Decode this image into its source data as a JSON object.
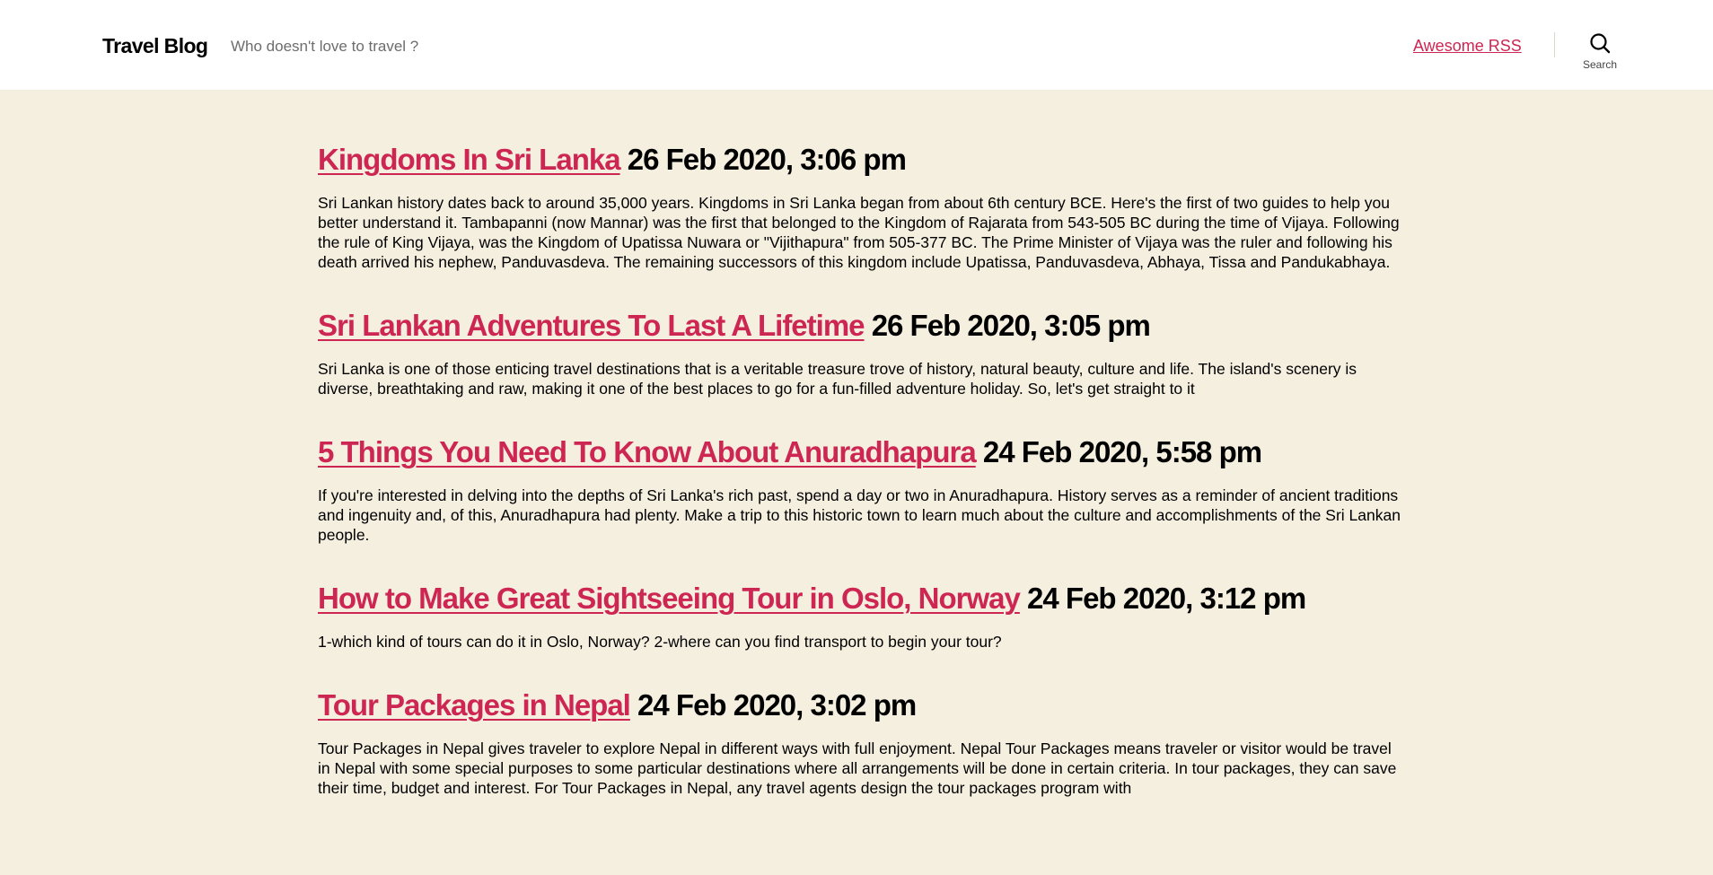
{
  "header": {
    "site_title": "Travel Blog",
    "site_description": "Who doesn't love to travel ?",
    "nav_link": "Awesome RSS",
    "search_label": "Search"
  },
  "posts": [
    {
      "title": "Kingdoms In Sri Lanka",
      "date": "26 Feb 2020, 3:06 pm",
      "excerpt": "Sri Lankan history dates back to around 35,000 years. Kingdoms in Sri Lanka began from about 6th century BCE. Here's the first of two guides to help you better understand it. Tambapanni (now Mannar) was the first that belonged to the Kingdom of Rajarata from 543-505 BC during the time of Vijaya. Following the rule of King Vijaya, was the Kingdom of Upatissa Nuwara or \"Vijithapura\" from 505-377 BC. The Prime Minister of Vijaya was the ruler and following his death arrived his nephew, Panduvasdeva. The remaining successors of this kingdom include Upatissa, Panduvasdeva, Abhaya, Tissa and Pandukabhaya."
    },
    {
      "title": "Sri Lankan Adventures To Last A Lifetime",
      "date": "26 Feb 2020, 3:05 pm",
      "excerpt": "Sri Lanka is one of those enticing travel destinations that is a veritable treasure trove of history, natural beauty, culture and life. The island's scenery is diverse, breathtaking and raw, making it one of the best places to go for a fun-filled adventure holiday. So, let's get straight to it"
    },
    {
      "title": "5 Things You Need To Know About Anuradhapura",
      "date": "24 Feb 2020, 5:58 pm",
      "excerpt": "If you're interested in delving into the depths of Sri Lanka's rich past, spend a day or two in Anuradhapura. History serves as a reminder of ancient traditions and ingenuity and, of this, Anuradhapura had plenty. Make a trip to this historic town to learn much about the culture and accomplishments of the Sri Lankan people."
    },
    {
      "title": "How to Make Great Sightseeing Tour in Oslo, Norway",
      "date": "24 Feb 2020, 3:12 pm",
      "excerpt": "1-which kind of tours can do it in Oslo, Norway? 2-where can you find transport to begin your tour?"
    },
    {
      "title": "Tour Packages in Nepal",
      "date": "24 Feb 2020, 3:02 pm",
      "excerpt": "Tour Packages in Nepal gives traveler to explore Nepal in different ways with full enjoyment. Nepal Tour Packages means traveler or visitor would be travel in Nepal with some special purposes to some particular destinations where all arrangements will be done in certain criteria. In tour packages, they can save their time, budget and interest. For Tour Packages in Nepal, any travel agents design the tour packages program with"
    }
  ]
}
